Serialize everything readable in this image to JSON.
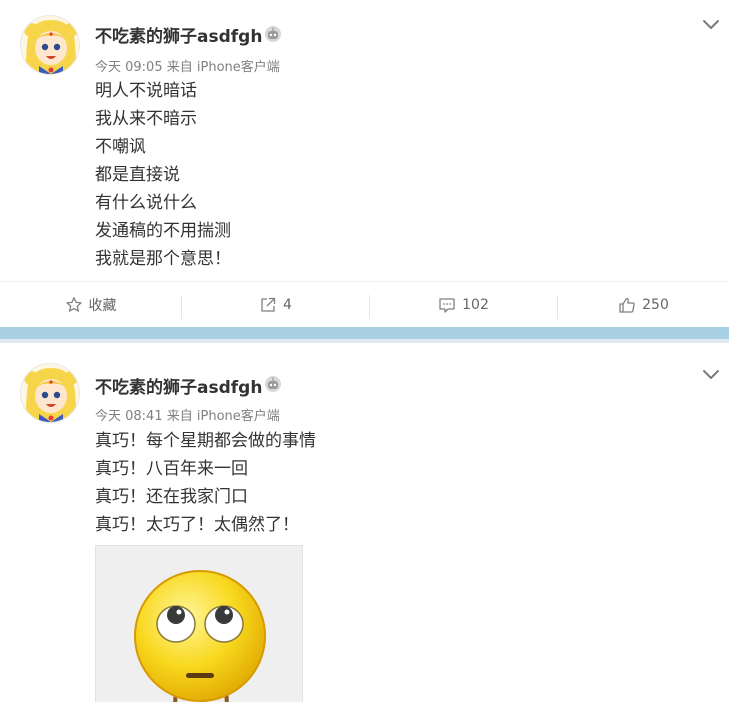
{
  "posts": [
    {
      "author": "不吃素的狮子asdfgh",
      "time": "今天 09:05",
      "source": "来自 iPhone客户端",
      "lines": [
        "明人不说暗话",
        "我从来不暗示",
        "不嘲讽",
        "都是直接说",
        "有什么说什么",
        "发通稿的不用揣测",
        "我就是那个意思！"
      ],
      "actions": {
        "favorite_label": "收藏",
        "repost_count": "4",
        "comment_count": "102",
        "like_count": "250"
      }
    },
    {
      "author": "不吃素的狮子asdfgh",
      "time": "今天 08:41",
      "source": "来自 iPhone客户端",
      "lines": [
        "真巧！每个星期都会做的事情",
        "真巧！八百年来一回",
        "真巧！还在我家门口",
        "真巧！太巧了！太偶然了！"
      ],
      "image": {
        "icon": "eye-roll-emoji-icon"
      }
    }
  ],
  "icons": {
    "avatar": "sailor-moon-avatar",
    "badge": "robot-badge-icon",
    "expand": "chevron-down-icon",
    "favorite": "star-icon",
    "repost": "share-icon",
    "comment": "comment-icon",
    "like": "thumbs-up-icon"
  },
  "colors": {
    "text": "#333333",
    "meta": "#808080",
    "separator": "#a9cfe3"
  }
}
